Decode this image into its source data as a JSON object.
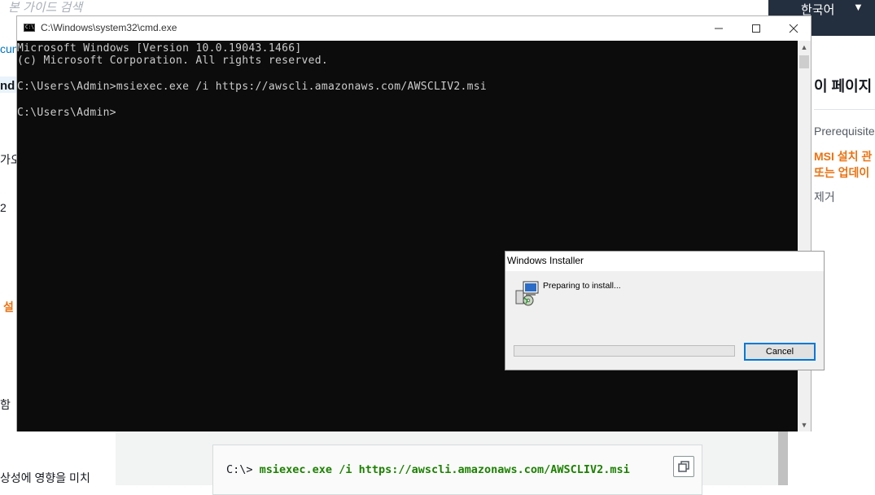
{
  "background_page": {
    "search_placeholder": "본 가이드 검색",
    "language_label": "한국어",
    "language_arrow": "▼",
    "left_nav_fragments": [
      "cun",
      "nd",
      "가오",
      "2",
      "설",
      "함",
      "상성에 영향을 미치"
    ],
    "right_toc": {
      "title": "이 페이지",
      "items": [
        "Prerequisite",
        "MSI 설치 관",
        "또는 업데이",
        "제거"
      ]
    },
    "code_sample": {
      "prompt": "C:\\>",
      "command": "msiexec.exe /i https://awscli.amazonaws.com/AWSCLIV2.msi"
    }
  },
  "cmd_window": {
    "title": "C:\\Windows\\system32\\cmd.exe",
    "icon_text": "C:\\",
    "lines": [
      "Microsoft Windows [Version 10.0.19043.1466]",
      "(c) Microsoft Corporation. All rights reserved.",
      "C:\\Users\\Admin>msiexec.exe /i https://awscli.amazonaws.com/AWSCLIV2.msi",
      "C:\\Users\\Admin>"
    ]
  },
  "installer_dialog": {
    "title": "Windows Installer",
    "message": "Preparing to install...",
    "cancel_label": "Cancel",
    "progress": 0
  },
  "colors": {
    "accent_orange": "#ec7211",
    "code_green": "#1d8102",
    "console_bg": "#0c0c0c",
    "header_dark": "#232f3e"
  },
  "icons": [
    "copy-icon",
    "minimize-icon",
    "maximize-icon",
    "close-icon",
    "installer-icon",
    "cmd-icon"
  ]
}
